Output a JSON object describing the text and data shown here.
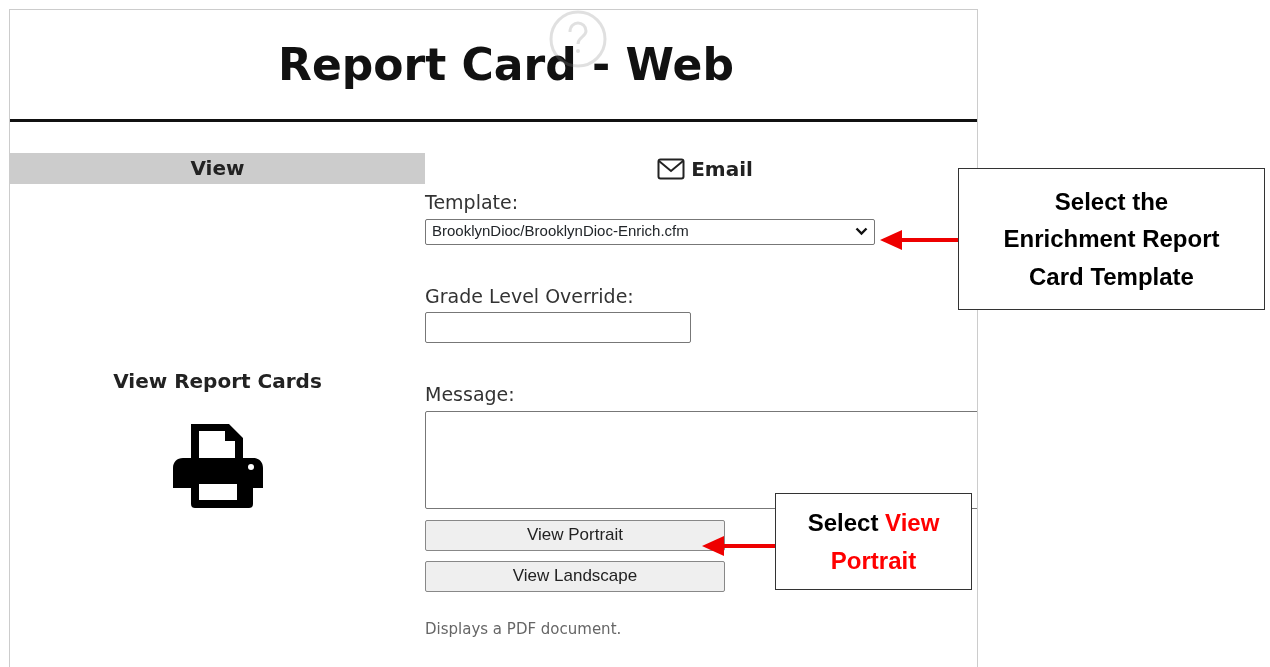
{
  "page": {
    "title": "Report Card - Web"
  },
  "view_panel": {
    "header": "View",
    "label": "View Report Cards"
  },
  "email_panel": {
    "header": "Email",
    "template_label": "Template:",
    "template_value": "BrooklynDioc/BrooklynDioc-Enrich.cfm",
    "grade_label": "Grade Level Override:",
    "message_label": "Message:",
    "buttons": [
      "View Portrait",
      "View Landscape"
    ],
    "note": "Displays a PDF document."
  },
  "callouts": [
    {
      "parts": [
        {
          "text": "Select the Enrichment Report Card Template",
          "highlight": false
        }
      ]
    },
    {
      "parts": [
        {
          "text": "Select ",
          "highlight": false
        },
        {
          "text": "View Portrait",
          "highlight": true
        }
      ]
    }
  ]
}
